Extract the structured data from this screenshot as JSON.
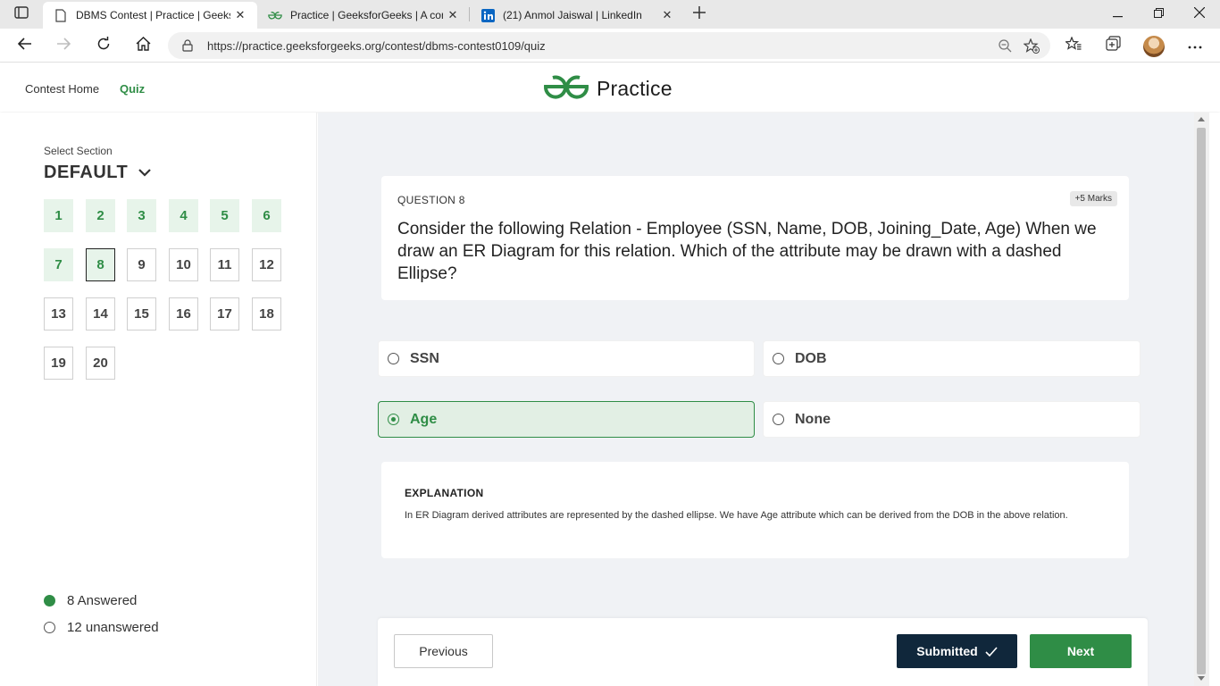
{
  "browser": {
    "tabs": [
      {
        "title": "DBMS Contest | Practice | GeeksforGeeks",
        "icon": "document-icon",
        "active": true
      },
      {
        "title": "Practice | GeeksforGeeks | A computer science portal for geeks",
        "icon": "gfg-icon",
        "active": false
      },
      {
        "title": "(21) Anmol Jaiswal | LinkedIn",
        "icon": "linkedin-icon",
        "active": false
      }
    ],
    "url": "https://practice.geeksforgeeks.org/contest/dbms-contest0109/quiz"
  },
  "header": {
    "nav": [
      {
        "label": "Contest Home"
      },
      {
        "label": "Quiz"
      }
    ],
    "brand": "Practice",
    "brand_color": "#2f8d46"
  },
  "sidebar": {
    "section_label": "Select Section",
    "section_name": "DEFAULT",
    "questions": [
      {
        "num": "1",
        "state": "answered"
      },
      {
        "num": "2",
        "state": "answered"
      },
      {
        "num": "3",
        "state": "answered"
      },
      {
        "num": "4",
        "state": "answered"
      },
      {
        "num": "5",
        "state": "answered"
      },
      {
        "num": "6",
        "state": "answered"
      },
      {
        "num": "7",
        "state": "answered"
      },
      {
        "num": "8",
        "state": "current-answered"
      },
      {
        "num": "9",
        "state": "unanswered"
      },
      {
        "num": "10",
        "state": "unanswered"
      },
      {
        "num": "11",
        "state": "unanswered"
      },
      {
        "num": "12",
        "state": "unanswered"
      },
      {
        "num": "13",
        "state": "unanswered"
      },
      {
        "num": "14",
        "state": "unanswered"
      },
      {
        "num": "15",
        "state": "unanswered"
      },
      {
        "num": "16",
        "state": "unanswered"
      },
      {
        "num": "17",
        "state": "unanswered"
      },
      {
        "num": "18",
        "state": "unanswered"
      },
      {
        "num": "19",
        "state": "unanswered"
      },
      {
        "num": "20",
        "state": "unanswered"
      }
    ],
    "answered_label": "8 Answered",
    "unanswered_label": "12 unanswered"
  },
  "question": {
    "number_label": "QUESTION 8",
    "marks": "+5 Marks",
    "text": "Consider the following Relation - Employee (SSN, Name, DOB, Joining_Date, Age) When we draw an ER Diagram for this relation. Which of the attribute may be drawn with a dashed Ellipse?",
    "options": [
      {
        "label": "SSN",
        "selected": false
      },
      {
        "label": "DOB",
        "selected": false
      },
      {
        "label": "Age",
        "selected": true
      },
      {
        "label": "None",
        "selected": false
      }
    ]
  },
  "explanation": {
    "title": "EXPLANATION",
    "text": "In ER Diagram derived attributes are represented by the dashed ellipse. We have Age attribute which can be derived from the DOB in the above relation."
  },
  "footer": {
    "previous_label": "Previous",
    "submitted_label": "Submitted",
    "next_label": "Next"
  }
}
